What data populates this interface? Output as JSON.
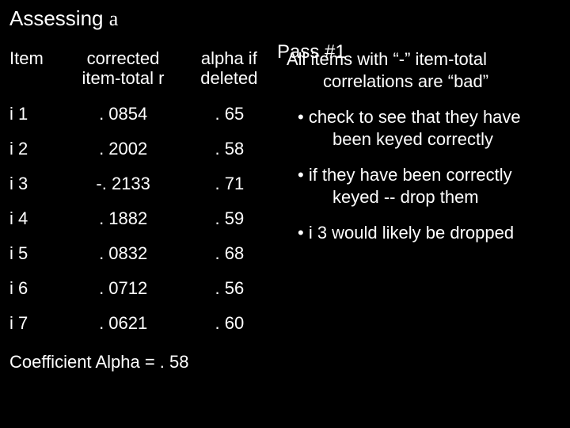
{
  "title_prefix": "Assessing ",
  "title_alpha": "a",
  "pass_label": "Pass #1",
  "headers": {
    "item": "Item",
    "corrected_l1": "corrected",
    "corrected_l2": "item-total r",
    "alpha_l1": "alpha if",
    "alpha_l2": "deleted"
  },
  "rows": [
    {
      "item": "i 1",
      "corr": ". 0854",
      "alpha": ". 65"
    },
    {
      "item": "i 2",
      "corr": ". 2002",
      "alpha": ". 58"
    },
    {
      "item": "i 3",
      "corr": "-. 2133",
      "alpha": ". 71"
    },
    {
      "item": "i 4",
      "corr": ". 1882",
      "alpha": ". 59"
    },
    {
      "item": "i 5",
      "corr": ". 0832",
      "alpha": ". 68"
    },
    {
      "item": "i 6",
      "corr": ". 0712",
      "alpha": ". 56"
    },
    {
      "item": "i 7",
      "corr": ". 0621",
      "alpha": ". 60"
    }
  ],
  "coef_label": "Coefficient Alpha =  . 58",
  "notes": {
    "intro": "All items with “-” item-total correlations are “bad”",
    "b1": "• check to see that they have been keyed correctly",
    "b2": "• if they have been correctly keyed --   drop them",
    "b3": "• i 3 would likely be dropped"
  },
  "chart_data": {
    "type": "table",
    "title": "Assessing alpha — Pass #1",
    "columns": [
      "Item",
      "corrected item-total r",
      "alpha if deleted"
    ],
    "data": [
      [
        "i1",
        0.0854,
        0.65
      ],
      [
        "i2",
        0.2002,
        0.58
      ],
      [
        "i3",
        -0.2133,
        0.71
      ],
      [
        "i4",
        0.1882,
        0.59
      ],
      [
        "i5",
        0.0832,
        0.68
      ],
      [
        "i6",
        0.0712,
        0.56
      ],
      [
        "i7",
        0.0621,
        0.6
      ]
    ],
    "coefficient_alpha": 0.58
  }
}
